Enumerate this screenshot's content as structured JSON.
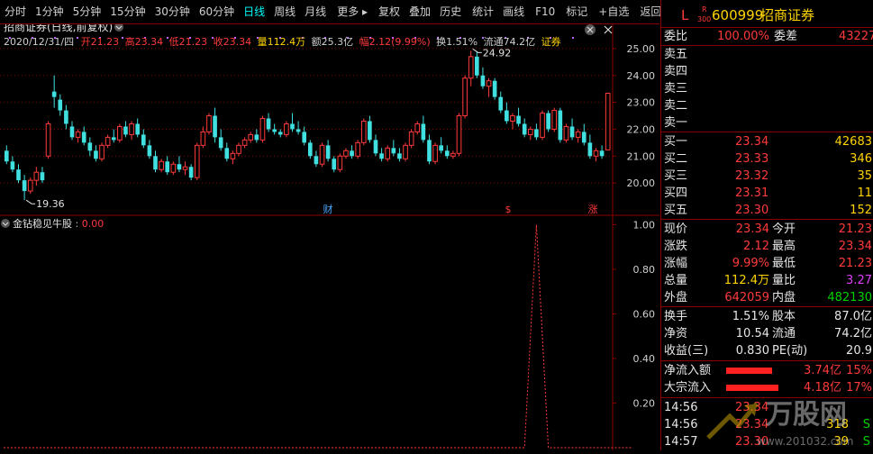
{
  "toolbar": {
    "items": [
      "分时",
      "1分钟",
      "5分钟",
      "15分钟",
      "30分钟",
      "60分钟",
      "日线",
      "周线",
      "月线",
      "更多",
      "复权",
      "叠加",
      "历史",
      "统计",
      "画线",
      "F10",
      "标记",
      "+自选",
      "返回"
    ]
  },
  "header": {
    "title": "招商证券(日线,前复权)",
    "date": "2020/12/31/四",
    "open_label": "开",
    "open": "21.23",
    "high_label": "高",
    "high": "23.34",
    "low_label": "低",
    "low": "21.23",
    "close_label": "收",
    "close": "23.34",
    "vol_label": "量",
    "vol": "112.4万",
    "amt_label": "额",
    "amt": "25.3亿",
    "chg_label": "幅",
    "chg": "2.12(9.99%)",
    "turn_label": "换",
    "turn": "1.51%",
    "float_label": "流通",
    "float": "74.2亿",
    "sector": "证券"
  },
  "indicator": {
    "title": "金钻稳见牛股",
    "value": "0.00"
  },
  "markers": {
    "cai": "财",
    "s": "$",
    "zhang": "涨"
  },
  "colors": {
    "up": "#ff3a3a",
    "down": "#40e0e0",
    "grid": "#8b0000",
    "indicator": "#ff3a3a"
  },
  "chart_data": [
    {
      "type": "candlestick",
      "title": "招商证券(日线,前复权)",
      "ylim": [
        19.2,
        25.4
      ],
      "yticks": [
        20.0,
        21.0,
        22.0,
        23.0,
        24.0,
        25.0
      ],
      "annotations": [
        {
          "label": "24.92",
          "type": "high"
        },
        {
          "label": "19.36",
          "type": "low"
        }
      ],
      "ohlc": [
        [
          21.2,
          21.4,
          20.7,
          20.8
        ],
        [
          20.8,
          21.0,
          20.4,
          20.5
        ],
        [
          20.5,
          20.7,
          20.0,
          20.1
        ],
        [
          20.1,
          20.3,
          19.36,
          19.7
        ],
        [
          19.7,
          20.2,
          19.6,
          20.1
        ],
        [
          20.1,
          20.6,
          19.9,
          20.4
        ],
        [
          20.4,
          20.6,
          20.0,
          20.1
        ],
        [
          21.0,
          22.3,
          20.9,
          22.2
        ],
        [
          23.4,
          24.0,
          22.8,
          23.2
        ],
        [
          23.1,
          23.3,
          22.5,
          22.7
        ],
        [
          22.7,
          22.9,
          22.0,
          22.2
        ],
        [
          22.1,
          22.3,
          21.6,
          21.7
        ],
        [
          21.7,
          22.0,
          21.5,
          21.9
        ],
        [
          21.9,
          22.1,
          21.4,
          21.5
        ],
        [
          21.5,
          21.7,
          21.0,
          21.2
        ],
        [
          21.2,
          21.4,
          20.8,
          20.9
        ],
        [
          20.9,
          21.5,
          20.8,
          21.4
        ],
        [
          21.4,
          21.8,
          21.3,
          21.7
        ],
        [
          21.7,
          22.0,
          21.5,
          21.6
        ],
        [
          21.6,
          22.2,
          21.5,
          22.1
        ],
        [
          22.1,
          22.3,
          21.7,
          21.8
        ],
        [
          21.8,
          22.3,
          21.6,
          22.2
        ],
        [
          22.2,
          22.4,
          21.7,
          21.8
        ],
        [
          21.8,
          22.0,
          21.3,
          21.4
        ],
        [
          21.4,
          21.6,
          20.9,
          21.0
        ],
        [
          21.0,
          21.2,
          20.4,
          20.5
        ],
        [
          20.5,
          20.9,
          20.4,
          20.8
        ],
        [
          20.8,
          21.0,
          20.3,
          20.4
        ],
        [
          20.4,
          20.8,
          20.3,
          20.7
        ],
        [
          20.7,
          21.0,
          20.4,
          20.5
        ],
        [
          20.5,
          20.8,
          20.3,
          20.6
        ],
        [
          20.6,
          20.7,
          20.1,
          20.2
        ],
        [
          20.2,
          21.5,
          20.1,
          21.4
        ],
        [
          21.4,
          22.1,
          21.3,
          21.9
        ],
        [
          21.9,
          22.6,
          21.8,
          22.5
        ],
        [
          22.5,
          22.8,
          21.5,
          21.7
        ],
        [
          21.7,
          22.0,
          21.2,
          21.3
        ],
        [
          21.3,
          21.5,
          20.8,
          20.9
        ],
        [
          20.9,
          21.2,
          20.7,
          21.1
        ],
        [
          21.1,
          21.5,
          21.0,
          21.4
        ],
        [
          21.4,
          21.7,
          21.3,
          21.6
        ],
        [
          21.6,
          21.9,
          21.5,
          21.8
        ],
        [
          21.8,
          22.0,
          21.5,
          21.6
        ],
        [
          21.6,
          22.5,
          21.5,
          22.4
        ],
        [
          22.4,
          22.6,
          21.9,
          22.0
        ],
        [
          22.0,
          22.2,
          21.8,
          21.9
        ],
        [
          21.9,
          22.0,
          21.7,
          21.8
        ],
        [
          21.8,
          22.3,
          21.7,
          22.2
        ],
        [
          22.2,
          22.6,
          21.9,
          22.0
        ],
        [
          22.0,
          22.3,
          21.8,
          21.9
        ],
        [
          21.9,
          22.1,
          21.4,
          21.5
        ],
        [
          21.5,
          21.6,
          20.9,
          21.0
        ],
        [
          21.0,
          21.2,
          20.6,
          20.7
        ],
        [
          20.7,
          21.5,
          20.6,
          21.4
        ],
        [
          21.4,
          21.6,
          20.8,
          20.9
        ],
        [
          20.9,
          21.0,
          20.4,
          20.5
        ],
        [
          20.5,
          21.1,
          20.4,
          21.0
        ],
        [
          21.0,
          21.3,
          20.9,
          21.2
        ],
        [
          21.2,
          21.4,
          20.9,
          21.0
        ],
        [
          21.0,
          21.6,
          20.9,
          21.5
        ],
        [
          21.5,
          22.4,
          21.4,
          22.3
        ],
        [
          22.3,
          22.5,
          21.5,
          21.6
        ],
        [
          21.6,
          21.8,
          21.0,
          21.1
        ],
        [
          21.1,
          21.3,
          20.8,
          20.9
        ],
        [
          20.9,
          21.4,
          20.8,
          21.3
        ],
        [
          21.3,
          21.6,
          21.0,
          21.1
        ],
        [
          21.1,
          21.3,
          20.8,
          20.9
        ],
        [
          20.9,
          21.5,
          20.8,
          21.4
        ],
        [
          21.4,
          22.0,
          21.3,
          21.9
        ],
        [
          21.9,
          22.3,
          21.8,
          22.2
        ],
        [
          22.2,
          22.5,
          21.5,
          21.6
        ],
        [
          21.6,
          21.8,
          20.7,
          20.8
        ],
        [
          20.8,
          21.5,
          20.7,
          21.4
        ],
        [
          21.4,
          21.7,
          21.1,
          21.2
        ],
        [
          21.2,
          21.4,
          20.9,
          21.0
        ],
        [
          21.0,
          21.2,
          20.9,
          21.1
        ],
        [
          21.1,
          22.6,
          21.0,
          22.5
        ],
        [
          22.5,
          24.0,
          22.4,
          23.9
        ],
        [
          23.9,
          24.92,
          23.6,
          24.7
        ],
        [
          24.7,
          24.9,
          23.9,
          24.0
        ],
        [
          24.0,
          24.3,
          23.5,
          23.6
        ],
        [
          23.6,
          23.9,
          23.2,
          23.8
        ],
        [
          23.8,
          23.9,
          23.1,
          23.2
        ],
        [
          23.2,
          23.4,
          22.6,
          22.7
        ],
        [
          22.7,
          23.0,
          22.2,
          22.3
        ],
        [
          22.3,
          22.6,
          22.0,
          22.5
        ],
        [
          22.5,
          22.8,
          22.1,
          22.2
        ],
        [
          22.2,
          22.4,
          21.7,
          21.8
        ],
        [
          21.8,
          22.1,
          21.6,
          22.0
        ],
        [
          22.0,
          22.2,
          21.6,
          21.7
        ],
        [
          21.7,
          22.7,
          21.6,
          22.6
        ],
        [
          22.6,
          22.7,
          21.9,
          22.0
        ],
        [
          22.0,
          22.8,
          21.9,
          22.7
        ],
        [
          22.7,
          22.8,
          21.5,
          21.6
        ],
        [
          21.6,
          22.2,
          21.5,
          22.1
        ],
        [
          22.1,
          22.4,
          21.6,
          21.7
        ],
        [
          21.7,
          22.0,
          21.5,
          21.9
        ],
        [
          21.9,
          22.2,
          21.4,
          21.5
        ],
        [
          21.5,
          21.8,
          20.9,
          21.0
        ],
        [
          21.0,
          21.3,
          20.8,
          21.2
        ],
        [
          21.2,
          21.4,
          20.9,
          21.0
        ],
        [
          21.23,
          23.34,
          21.23,
          23.34
        ]
      ]
    },
    {
      "type": "line",
      "title": "金钻稳见牛股",
      "ylim": [
        0,
        1.05
      ],
      "yticks": [
        0.2,
        0.4,
        0.6,
        0.8,
        1.0
      ],
      "series": [
        {
          "name": "金钻稳见牛股",
          "x_index": [
            0,
            87,
            88,
            89,
            90,
            91,
            105
          ],
          "values": [
            0,
            0,
            0.5,
            1.0,
            0.5,
            0,
            0
          ]
        }
      ]
    }
  ],
  "right_panel": {
    "code_prefix": "L",
    "code_sup": "R",
    "code_sub": "300",
    "code": "600999",
    "name": "招商证券",
    "weibi_label": "委比",
    "weibi": "100.00%",
    "weicha_label": "委差",
    "weicha": "43227",
    "sells": [
      {
        "label": "卖五",
        "price": "",
        "vol": ""
      },
      {
        "label": "卖四",
        "price": "",
        "vol": ""
      },
      {
        "label": "卖三",
        "price": "",
        "vol": ""
      },
      {
        "label": "卖二",
        "price": "",
        "vol": ""
      },
      {
        "label": "卖一",
        "price": "",
        "vol": ""
      }
    ],
    "buys": [
      {
        "label": "买一",
        "price": "23.34",
        "vol": "42683"
      },
      {
        "label": "买二",
        "price": "23.33",
        "vol": "346"
      },
      {
        "label": "买三",
        "price": "23.32",
        "vol": "35"
      },
      {
        "label": "买四",
        "price": "23.31",
        "vol": "11"
      },
      {
        "label": "买五",
        "price": "23.30",
        "vol": "152"
      }
    ],
    "stats1": [
      {
        "l1": "现价",
        "v1": "23.34",
        "l2": "今开",
        "v2": "21.23"
      },
      {
        "l1": "涨跌",
        "v1": "2.12",
        "l2": "最高",
        "v2": "23.34"
      },
      {
        "l1": "涨幅",
        "v1": "9.99%",
        "l2": "最低",
        "v2": "21.23"
      },
      {
        "l1": "总量",
        "v1": "112.4万",
        "l2": "量比",
        "v2": "3.27"
      },
      {
        "l1": "外盘",
        "v1": "642059",
        "l2": "内盘",
        "v2": "482130"
      }
    ],
    "stats2": [
      {
        "l1": "换手",
        "v1": "1.51%",
        "l2": "股本",
        "v2": "87.0亿"
      },
      {
        "l1": "净资",
        "v1": "10.54",
        "l2": "流通",
        "v2": "74.2亿"
      },
      {
        "l1": "收益(三)",
        "v1": "0.830",
        "l2": "PE(动)",
        "v2": "20.9"
      }
    ],
    "flows": [
      {
        "label": "净流入额",
        "value": "3.74亿",
        "pct": "15%",
        "fill": 0.15
      },
      {
        "label": "大宗流入",
        "value": "4.18亿",
        "pct": "17%",
        "fill": 0.17
      }
    ],
    "ticks": [
      {
        "time": "14:56",
        "price": "23.34",
        "vol": "",
        "flag": ""
      },
      {
        "time": "14:56",
        "price": "23.34",
        "vol": "318",
        "flag": "S"
      },
      {
        "time": "14:57",
        "price": "23.30",
        "vol": "39",
        "flag": "S"
      }
    ],
    "watermark_text": "万股网",
    "watermark_url": "www.201032.com"
  }
}
